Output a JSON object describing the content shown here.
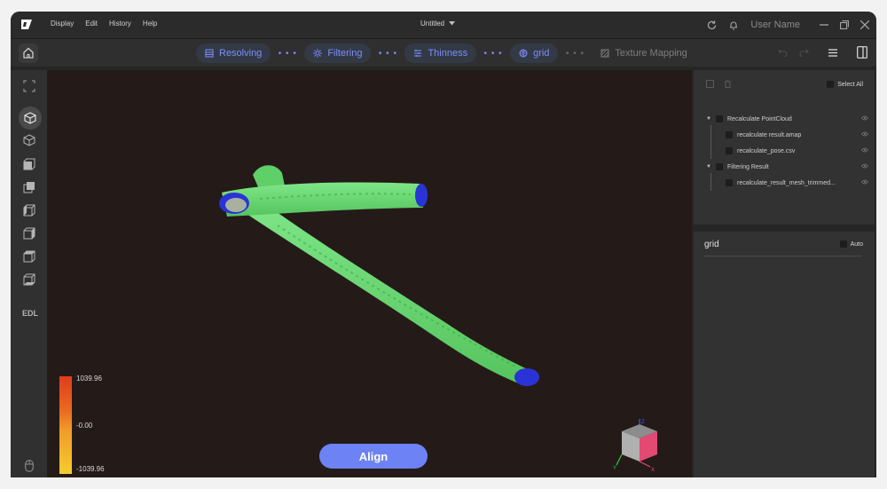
{
  "menu": [
    "Display",
    "Edit",
    "History",
    "Help"
  ],
  "document": {
    "title": "Untitled"
  },
  "user": {
    "name": "User Name"
  },
  "workflow": {
    "steps": [
      {
        "label": "Resolving",
        "icon": "resolving-icon",
        "state": "done"
      },
      {
        "label": "Filtering",
        "icon": "filtering-icon",
        "state": "done"
      },
      {
        "label": "Thinness",
        "icon": "thinness-icon",
        "state": "done"
      },
      {
        "label": "grid",
        "icon": "grid-icon",
        "state": "active"
      },
      {
        "label": "Texture Mapping",
        "icon": "texture-icon",
        "state": "pending"
      }
    ]
  },
  "left_tools": {
    "items": [
      "fit-view-icon",
      "solid-cube-icon",
      "wire-cube-icon",
      "front-view-icon",
      "back-view-icon",
      "left-view-icon",
      "right-view-icon",
      "top-view-icon",
      "bottom-view-icon"
    ],
    "edl_label": "EDL"
  },
  "viewport": {
    "legend": {
      "max": "1039.96",
      "mid": "-0.00",
      "min": "-1039.96"
    },
    "align_label": "Align",
    "axis_labels": {
      "x": "X",
      "y": "Y",
      "z": "Z"
    }
  },
  "scene_panel": {
    "select_all_label": "Select All",
    "tree": [
      {
        "label": "Recalculate PointCloud",
        "level": 0,
        "expanded": true
      },
      {
        "label": "recalculate result.amap",
        "level": 1
      },
      {
        "label": "recalculate_pose.csv",
        "level": 1
      },
      {
        "label": "Filtering Result",
        "level": 0,
        "expanded": true
      },
      {
        "label": "recalculate_result_mesh_trimmed...",
        "level": 1
      }
    ]
  },
  "grid_panel": {
    "title": "grid",
    "auto_label": "Auto"
  },
  "colors": {
    "accent": "#7c8dfc",
    "align_button": "#6d82f5",
    "viewport_bg": "#241b19",
    "mesh": "#6fd877",
    "mesh_cap": "#2a34d6"
  }
}
